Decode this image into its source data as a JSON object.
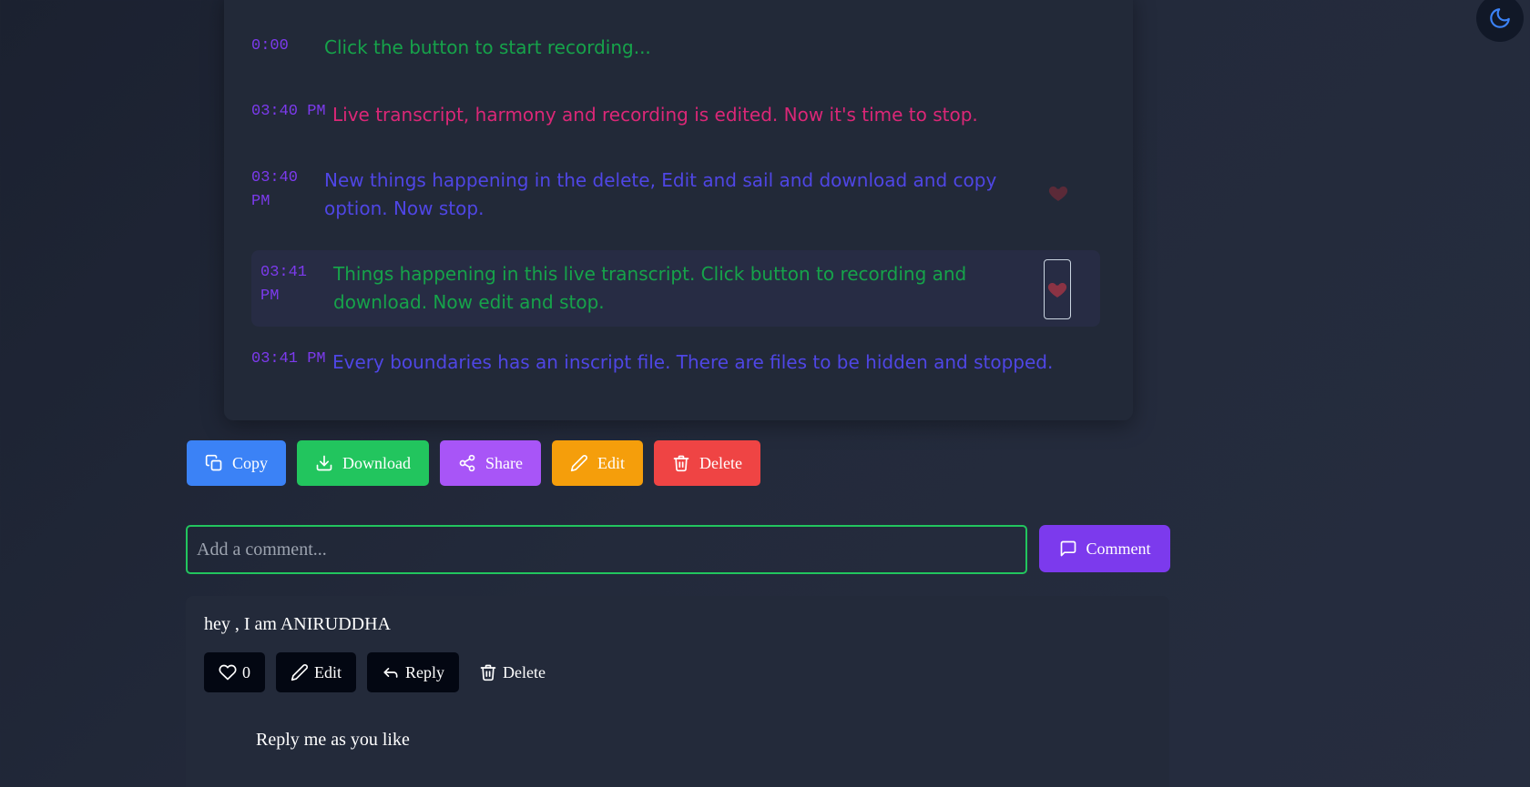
{
  "theme_toggle": {
    "icon": "moon-icon"
  },
  "transcript": {
    "entries": [
      {
        "time": "0:00",
        "text": "Click the button to start recording...",
        "color": "#16a34a"
      },
      {
        "time": "03:40 PM",
        "text": "Live transcript, harmony and recording is edited. Now it's time to stop.",
        "color": "#db2777"
      },
      {
        "time": "03:40 PM",
        "text": "New things happening in the delete, Edit and sail and download and copy option. Now stop.",
        "color": "#4f46e5"
      },
      {
        "time": "03:41 PM",
        "text": "Things happening in this live transcript. Click button to recording and download. Now edit and stop.",
        "color": "#16a34a"
      },
      {
        "time": "03:41 PM",
        "text": "Every boundaries has an inscript file. There are files to be hidden and stopped.",
        "color": "#4f46e5"
      }
    ]
  },
  "actions": {
    "copy": "Copy",
    "download": "Download",
    "share": "Share",
    "edit": "Edit",
    "delete": "Delete"
  },
  "comment_form": {
    "placeholder": "Add a comment...",
    "submit": "Comment"
  },
  "comment": {
    "text": "hey , I am ANIRUDDHA",
    "likes": "0",
    "edit": "Edit",
    "reply": "Reply",
    "delete": "Delete",
    "reply_text": "Reply me as you like"
  },
  "colors": {
    "accent": "#7c3aed",
    "copy": "#3b82f6",
    "download": "#22c55e",
    "share": "#a855f7",
    "edit": "#f59e0b",
    "delete": "#ef4444"
  }
}
